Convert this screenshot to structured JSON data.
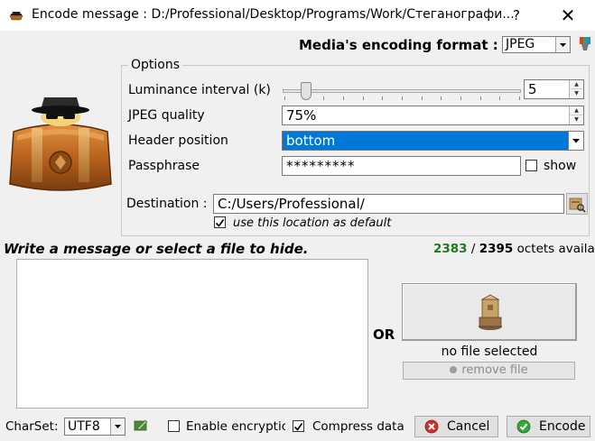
{
  "window": {
    "title": "Encode message : D:/Professional/Desktop/Programs/Work/Стеганографи...",
    "help_label": "?",
    "close_label": "✕"
  },
  "media": {
    "label": "Media's encoding format :",
    "format": "JPEG"
  },
  "options": {
    "title": "Options",
    "luminance_label": "Luminance interval (k)",
    "luminance_value": "5",
    "luminance_slider_fraction": 0.08,
    "jpeg_quality_label": "JPEG quality",
    "jpeg_quality_value": "75%",
    "header_position_label": "Header position",
    "header_position_value": "bottom",
    "passphrase_label": "Passphrase",
    "passphrase_value": "*********",
    "show_label": "show",
    "show_checked": false,
    "destination_label": "Destination :",
    "destination_value": "C:/Users/Professional/",
    "default_label": "use this location as default",
    "default_checked": true
  },
  "message": {
    "heading": "Write a message or select a file to hide.",
    "octets_used": "2383",
    "octets_separator": " / ",
    "octets_total": "2395",
    "octets_suffix": " octets available",
    "text": "",
    "or_label": "OR",
    "no_file_label": "no file selected",
    "remove_file_label": "remove file"
  },
  "footer": {
    "charset_label": "CharSet:",
    "charset_value": "UTF8",
    "encryption_label": "Enable encryption",
    "encryption_checked": false,
    "compress_label": "Compress data",
    "compress_checked": true,
    "cancel_label": "Cancel",
    "encode_label": "Encode"
  },
  "icons": {
    "title": "spy-icon",
    "palette": "palette-icon",
    "main": "spy-briefcase-icon",
    "browse": "browse-folder-icon",
    "file": "file-package-icon",
    "remove": "remove-icon",
    "charset": "charset-edit-icon",
    "cancel": "cancel-icon",
    "encode": "encode-check-icon"
  },
  "colors": {
    "selection": "#0078d7",
    "octets_used": "#1f7a1f",
    "cancel_icon": "#d32f2f",
    "encode_icon": "#3aa53a"
  }
}
